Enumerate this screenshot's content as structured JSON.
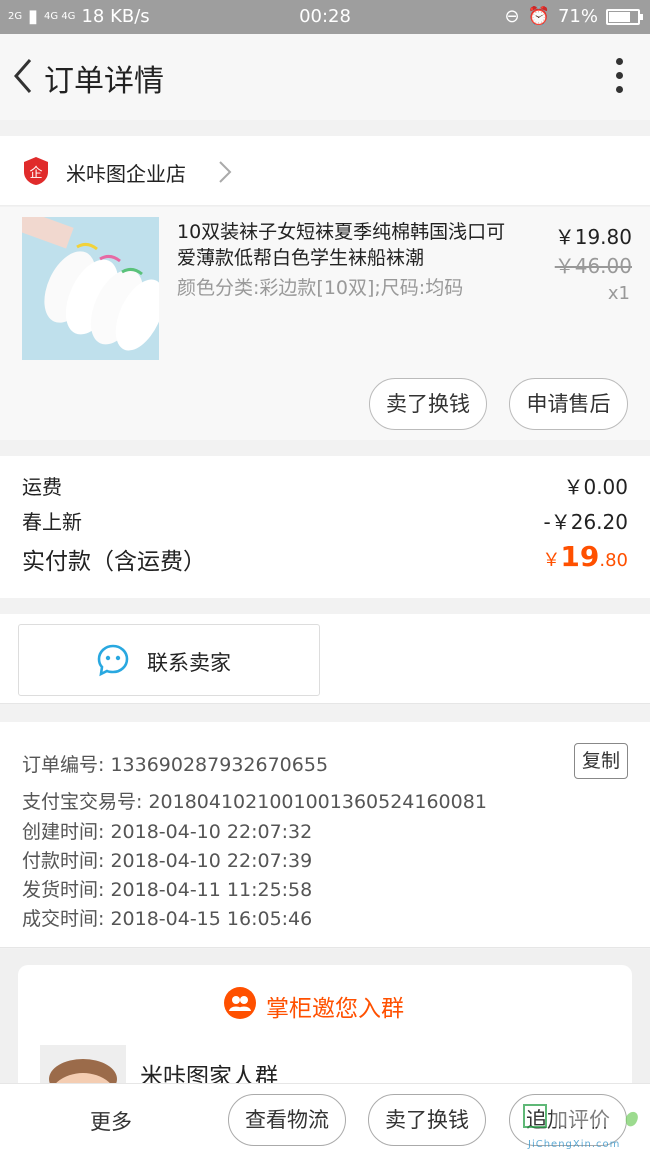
{
  "status_bar": {
    "network": "2G",
    "network2": "4G 4G",
    "speed": "18 KB/s",
    "time": "00:28",
    "battery": "71%"
  },
  "header": {
    "title": "订单详情"
  },
  "shop": {
    "name": "米咔图企业店"
  },
  "product": {
    "title": "10双装袜子女短袜夏季纯棉韩国浅口可爱薄款低帮白色学生袜船袜潮",
    "sku": "颜色分类:彩边款[10双];尺码:均码",
    "price": "￥19.80",
    "original_price": "￥46.00",
    "quantity": "x1",
    "actions": [
      "卖了换钱",
      "申请售后"
    ]
  },
  "fees": {
    "shipping_label": "运费",
    "shipping_value": "￥0.00",
    "discount_label": "春上新",
    "discount_value": "-￥26.20",
    "total_label": "实付款（含运费）",
    "total_currency": "￥",
    "total_integer": "19",
    "total_decimal": ".80"
  },
  "contact": {
    "label": "联系卖家"
  },
  "order_info": {
    "order_no": "订单编号: 133690287932670655",
    "copy_label": "复制",
    "alipay_no": "支付宝交易号: 2018041021001001360524160081",
    "created": "创建时间: 2018-04-10 22:07:32",
    "paid": "付款时间: 2018-04-10 22:07:39",
    "shipped": "发货时间: 2018-04-11 11:25:58",
    "completed": "成交时间: 2018-04-15 16:05:46"
  },
  "group": {
    "title": "掌柜邀您入群",
    "name": "米咔图家人群"
  },
  "bottom_bar": {
    "more": "更多",
    "logistics": "查看物流",
    "resell": "卖了换钱",
    "review": "追加评价"
  },
  "watermark": {
    "text": "JiChengXin.com"
  },
  "colors": {
    "accent": "#ff5000",
    "chat_icon": "#29a8e0",
    "shop_logo": "#e02b2b"
  }
}
